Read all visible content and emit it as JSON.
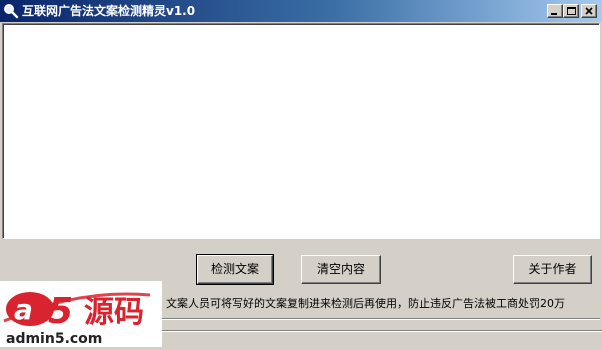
{
  "window": {
    "title": "互联网广告法文案检测精灵v1.0",
    "icon": "magnifier-icon"
  },
  "editor": {
    "value": ""
  },
  "buttons": {
    "detect": "检测文案",
    "clear": "清空内容",
    "about": "关于作者"
  },
  "notice": "文案人员可将写好的文案复制进来检测后再使用，防止违反广告法被工商处罚20万",
  "watermark": {
    "brand": "a5源码",
    "site": "admin5.com"
  },
  "colors": {
    "titlebar_start": "#0a246a",
    "titlebar_end": "#a6caf0",
    "face": "#d4d0c8",
    "watermark_red": "#d9232e"
  }
}
